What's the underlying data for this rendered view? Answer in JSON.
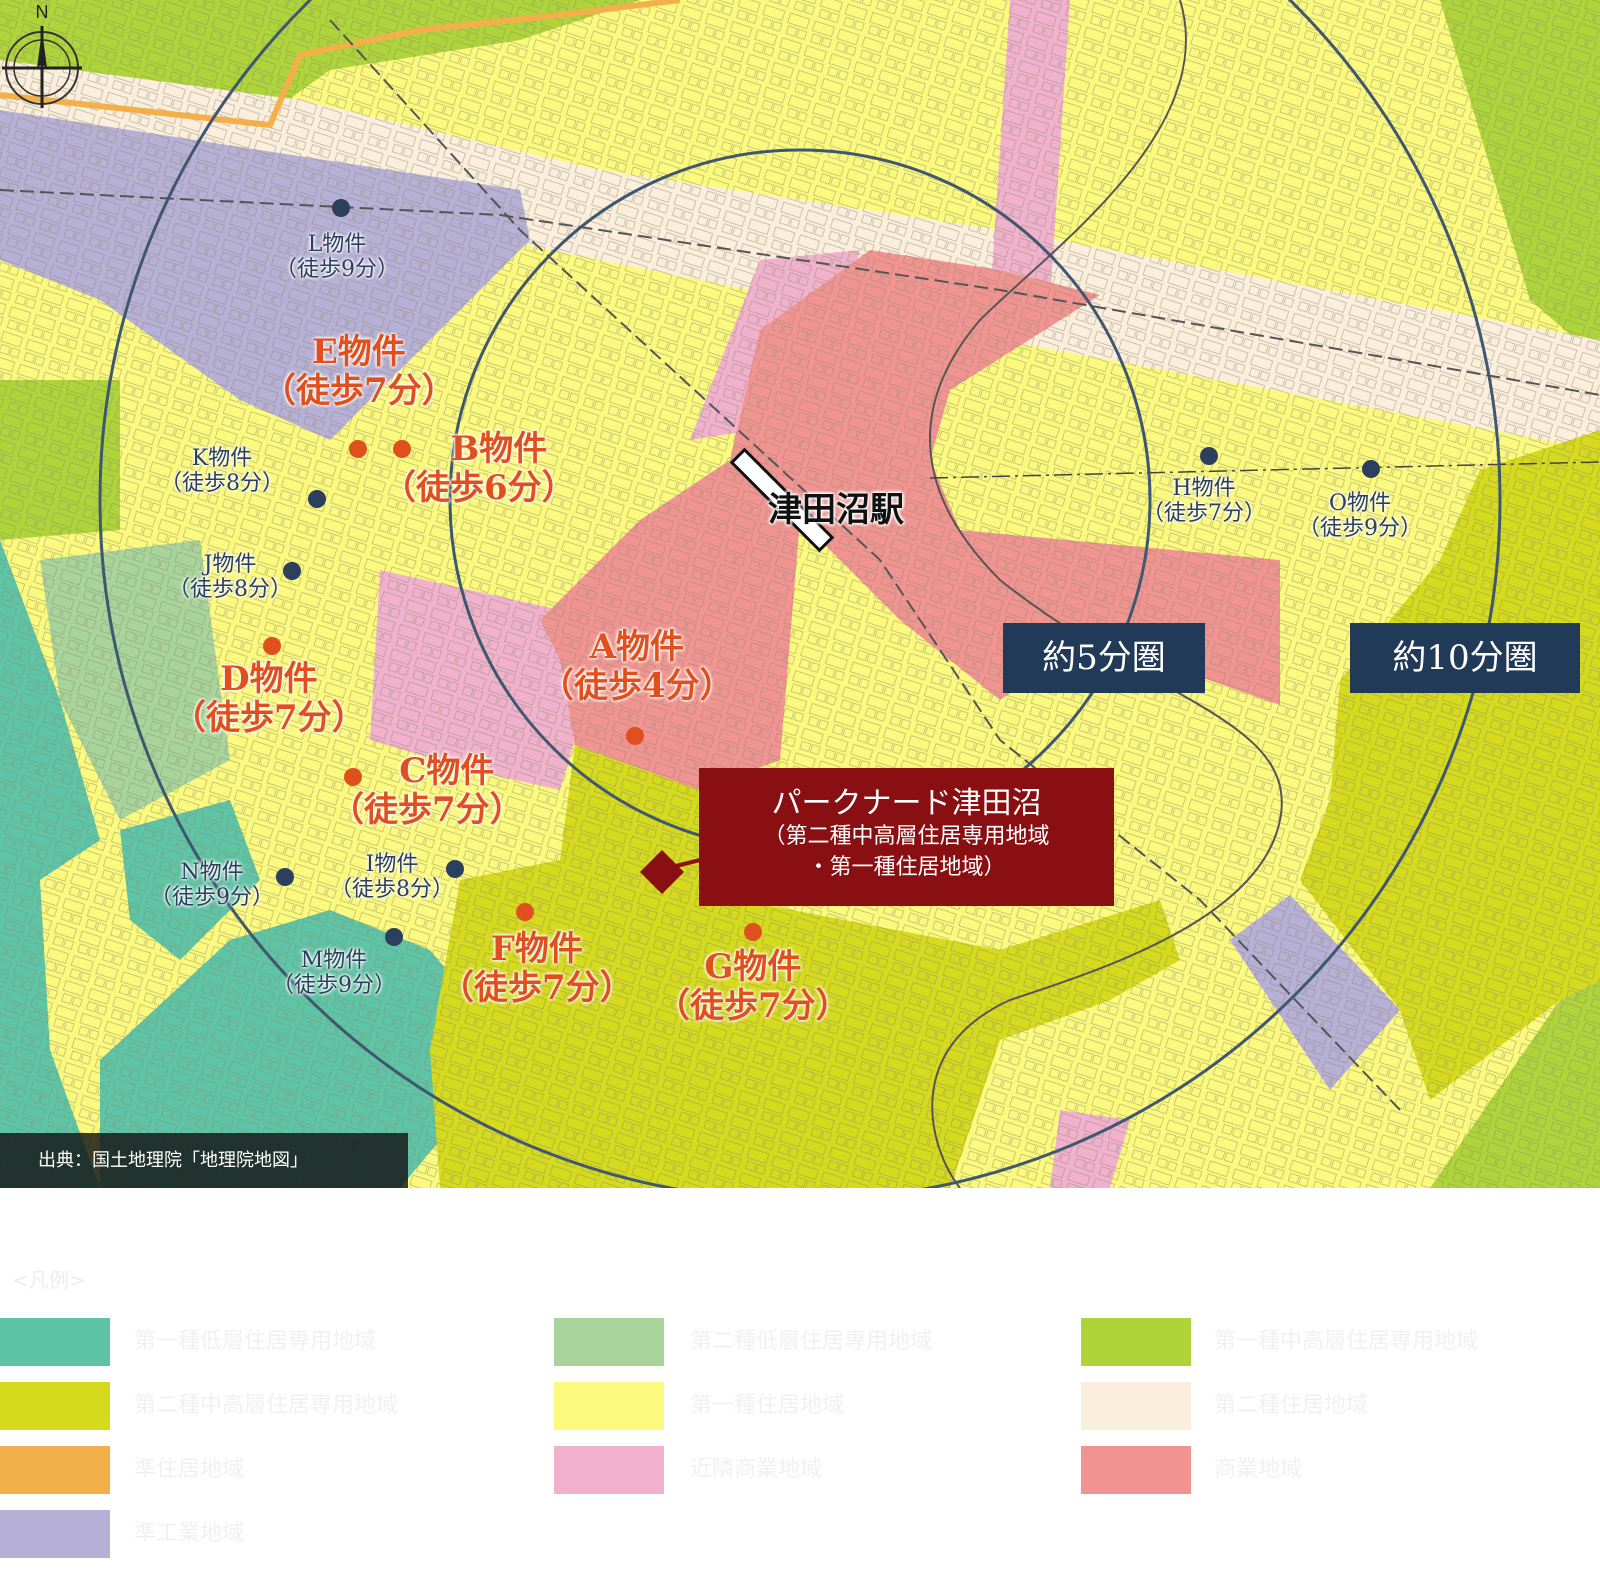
{
  "map": {
    "station_label": "津田沼駅",
    "ring_labels": {
      "inner": "約5分圏",
      "outer": "約10分圏"
    },
    "site": {
      "name": "パークナード津田沼",
      "zoning_line1": "（第二種中高層住居専用地域",
      "zoning_line2": "・第一種住居地域）"
    },
    "credit": "出典：国土地理院「地理院地図」",
    "compass_letter": "N",
    "properties": {
      "A": {
        "name": "A物件",
        "walk": "（徒歩4分）"
      },
      "B": {
        "name": "B物件",
        "walk": "（徒歩6分）"
      },
      "C": {
        "name": "C物件",
        "walk": "（徒歩7分）"
      },
      "D": {
        "name": "D物件",
        "walk": "（徒歩7分）"
      },
      "E": {
        "name": "E物件",
        "walk": "（徒歩7分）"
      },
      "F": {
        "name": "F物件",
        "walk": "（徒歩7分）"
      },
      "G": {
        "name": "G物件",
        "walk": "（徒歩7分）"
      },
      "H": {
        "name": "H物件",
        "walk": "（徒歩7分）"
      },
      "I": {
        "name": "I物件",
        "walk": "（徒歩8分）"
      },
      "J": {
        "name": "J物件",
        "walk": "（徒歩8分）"
      },
      "K": {
        "name": "K物件",
        "walk": "（徒歩8分）"
      },
      "L": {
        "name": "L物件",
        "walk": "（徒歩9分）"
      },
      "M": {
        "name": "M物件",
        "walk": "（徒歩9分）"
      },
      "N": {
        "name": "N物件",
        "walk": "（徒歩9分）"
      },
      "O": {
        "name": "O物件",
        "walk": "（徒歩9分）"
      }
    },
    "colors": {
      "teal": "#5ec4a6",
      "lightgreen_zone": "#a8d49b",
      "green": "#aed43a",
      "olive": "#d6da1d",
      "yellow": "#fbf97e",
      "cream": "#fbeedd",
      "orange": "#f3b04a",
      "pink": "#f1b1cd",
      "salmon": "#f19491",
      "lavender": "#b6afd6",
      "site": "#8a0f12",
      "navy": "#213a58",
      "major_label": "#e0501e",
      "minor_label": "#2b3f5e"
    }
  },
  "legend": {
    "title": "<凡例>",
    "swatches": [
      {
        "id": "teal",
        "color": "#5ec4a6",
        "text": "第一種低層住居専用地域"
      },
      {
        "id": "lightgreen",
        "color": "#a8d49b",
        "text": "第二種低層住居専用地域"
      },
      {
        "id": "green",
        "color": "#aed43a",
        "text": "第一種中高層住居専用地域"
      },
      {
        "id": "olive",
        "color": "#d6da1d",
        "text": "第二種中高層住居専用地域"
      },
      {
        "id": "yellow",
        "color": "#fbf97e",
        "text": "第一種住居地域"
      },
      {
        "id": "cream",
        "color": "#fbeedd",
        "text": "第二種住居地域"
      },
      {
        "id": "orange",
        "color": "#f3b04a",
        "text": "準住居地域"
      },
      {
        "id": "pink",
        "color": "#f1b1cd",
        "text": "近隣商業地域"
      },
      {
        "id": "salmon",
        "color": "#f19491",
        "text": "商業地域"
      },
      {
        "id": "lavender",
        "color": "#b6afd6",
        "text": "準工業地域"
      }
    ]
  }
}
